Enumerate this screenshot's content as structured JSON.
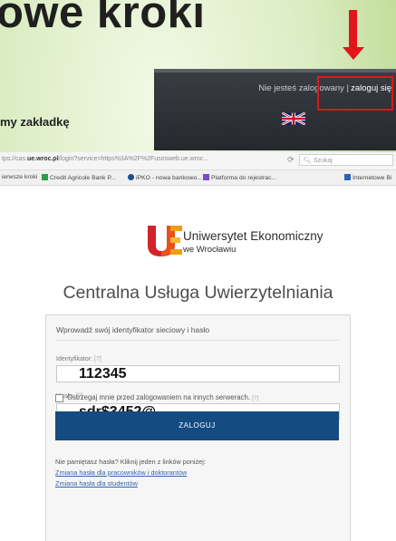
{
  "slide": {
    "title": "owe kroki",
    "subtext": "my zakładkę"
  },
  "site_header": {
    "not_logged_in": "Nie jesteś zalogowany |",
    "login_link": "zaloguj się",
    "flag_icon": "uk-flag-icon"
  },
  "browser": {
    "url_prefix": "tps://cas.",
    "url_host": "ue.wroc.pl",
    "url_rest": "/login?service=https%3A%2F%2Fusosweb.ue.wroc...",
    "search_placeholder": "Szukaj",
    "bookmarks": [
      "ierwsze kroki",
      "Credit Agricole Bank P...",
      "iPKO - nowa bankowo...",
      "Platforma do rejestrac...",
      "Internetowe Bi"
    ]
  },
  "university": {
    "name": "Uniwersytet Ekonomiczny",
    "city": "we Wrocławiu"
  },
  "service_title": "Centralna Usługa Uwierzytelniania",
  "login_form": {
    "intro": "Wprowadź swój identyfikator sieciowy i hasło",
    "id_label": "Identyfikator:",
    "id_help": "[?]",
    "id_value": "112345",
    "password_label": "Hasło:",
    "password_help": "[?]",
    "password_value": "sdr$3452@",
    "warn_label": "Ostrzegaj mnie przed zalogowaniem na innych serwerach.",
    "warn_help": "[?]",
    "warn_checked": false,
    "submit_label": "ZALOGUJ",
    "forgot_text": "Nie pamiętasz hasła? Kliknij jeden z linków poniżej:",
    "reset_links": [
      "Zmiana hasła dla pracowników i doktorantów",
      "Zmiana hasła dla studentów"
    ]
  },
  "colors": {
    "accent_red": "#e3141b",
    "button_blue": "#144b80",
    "link_blue": "#3366aa",
    "logo_red": "#d2232a",
    "logo_orange": "#f39c12"
  }
}
